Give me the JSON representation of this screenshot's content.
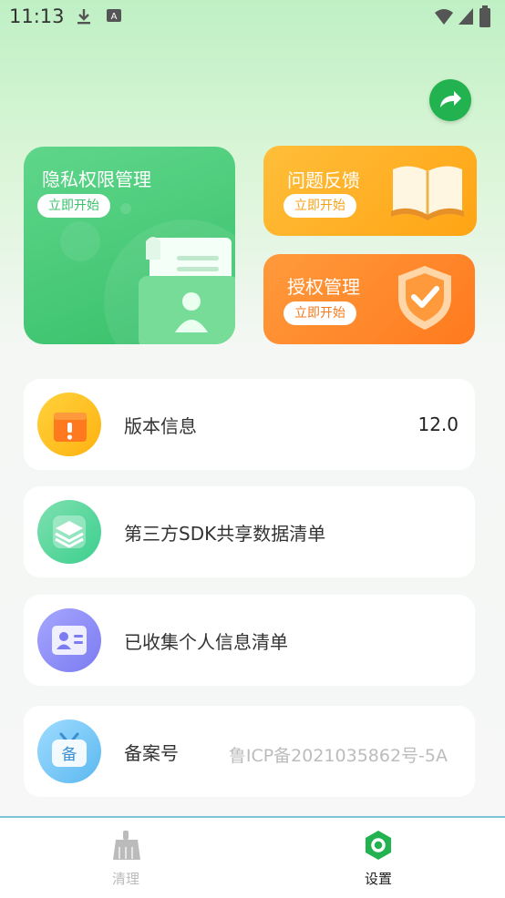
{
  "status_bar": {
    "time": "11:13",
    "icons": [
      "download-icon",
      "a-badge-icon",
      "wifi-icon",
      "signal-icon",
      "battery-icon"
    ]
  },
  "share_icon": "share-arrow-icon",
  "cards": {
    "privacy": {
      "title": "隐私权限管理",
      "button": "立即开始"
    },
    "feedback": {
      "title": "问题反馈",
      "button": "立即开始"
    },
    "auth": {
      "title": "授权管理",
      "button": "立即开始"
    }
  },
  "list": [
    {
      "label": "版本信息",
      "value": "12.0",
      "icon": "version-info-icon"
    },
    {
      "label": "第三方SDK共享数据清单",
      "value": "",
      "icon": "layers-icon"
    },
    {
      "label": "已收集个人信息清单",
      "value": "",
      "icon": "id-card-icon"
    },
    {
      "label": "备案号",
      "value": "鲁ICP备2021035862号-5A",
      "icon": "record-tv-icon"
    }
  ],
  "tabs": [
    {
      "label": "清理",
      "icon": "broom-icon",
      "active": false
    },
    {
      "label": "设置",
      "icon": "settings-hex-icon",
      "active": true
    }
  ],
  "colors": {
    "green": "#38c06a",
    "yellow": "#ffa414",
    "orange": "#ff7a1e",
    "tab_inactive": "#bbbbbb",
    "tab_active": "#222222"
  }
}
